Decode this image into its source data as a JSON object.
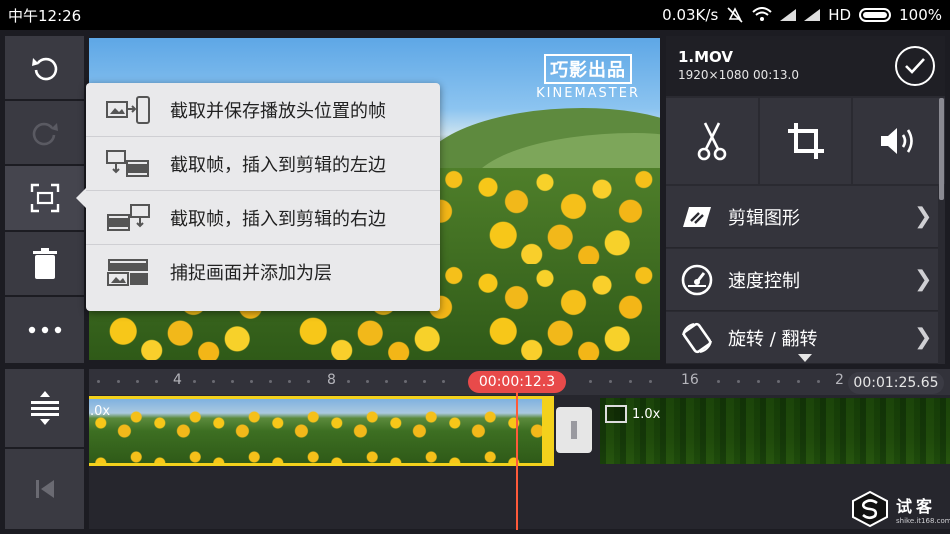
{
  "status_bar": {
    "time": "中午12:26",
    "network_speed": "0.03K/s",
    "network_type": "HD",
    "battery": "100%"
  },
  "left_toolbar": {
    "items": [
      {
        "name": "undo",
        "icon": "undo-icon",
        "enabled": true
      },
      {
        "name": "redo",
        "icon": "redo-icon",
        "enabled": false
      },
      {
        "name": "capture-frame",
        "icon": "capture-frame-icon",
        "enabled": true
      },
      {
        "name": "delete",
        "icon": "trash-icon",
        "enabled": true
      },
      {
        "name": "more",
        "icon": "more-dots-icon",
        "enabled": true
      },
      {
        "name": "timeline-expand",
        "icon": "expand-timeline-icon",
        "enabled": true
      },
      {
        "name": "jump-to-start",
        "icon": "skip-start-icon",
        "enabled": false
      }
    ]
  },
  "preview": {
    "watermark_top": "巧影出品",
    "watermark_bottom": "KINEMASTER"
  },
  "capture_menu": {
    "items": [
      {
        "label": "截取并保存播放头位置的帧",
        "icon": "save-frame-icon"
      },
      {
        "label": "截取帧，插入到剪辑的左边",
        "icon": "insert-left-icon"
      },
      {
        "label": "截取帧，插入到剪辑的右边",
        "icon": "insert-right-icon"
      },
      {
        "label": "捕捉画面并添加为层",
        "icon": "capture-layer-icon"
      }
    ]
  },
  "clip_panel": {
    "file_name": "1.MOV",
    "file_info": "1920×1080  00:13.0",
    "tools": [
      {
        "name": "trim",
        "icon": "scissors-icon"
      },
      {
        "name": "crop",
        "icon": "crop-icon"
      },
      {
        "name": "volume",
        "icon": "volume-icon"
      }
    ],
    "menu": [
      {
        "label": "剪辑图形",
        "icon": "clip-graphics-icon"
      },
      {
        "label": "速度控制",
        "icon": "speed-gauge-icon"
      },
      {
        "label": "旋转 / 翻转",
        "icon": "rotate-icon"
      }
    ]
  },
  "timeline": {
    "ruler_labels": [
      "4",
      "8",
      "16",
      "2"
    ],
    "playhead_time": "00:00:12.3",
    "total_time": "00:01:25.65",
    "clip1_speed": ".0x",
    "clip2_speed": "1.0x"
  },
  "site_logo": {
    "name": "试客",
    "url": "shike.it168.com"
  },
  "colors": {
    "accent_yellow": "#f3d11c",
    "playhead_red": "#e84a4a",
    "panel_dark": "#2a2a31",
    "toolbar_button": "#3a3a42",
    "menu_bg": "#e9e9eb"
  }
}
